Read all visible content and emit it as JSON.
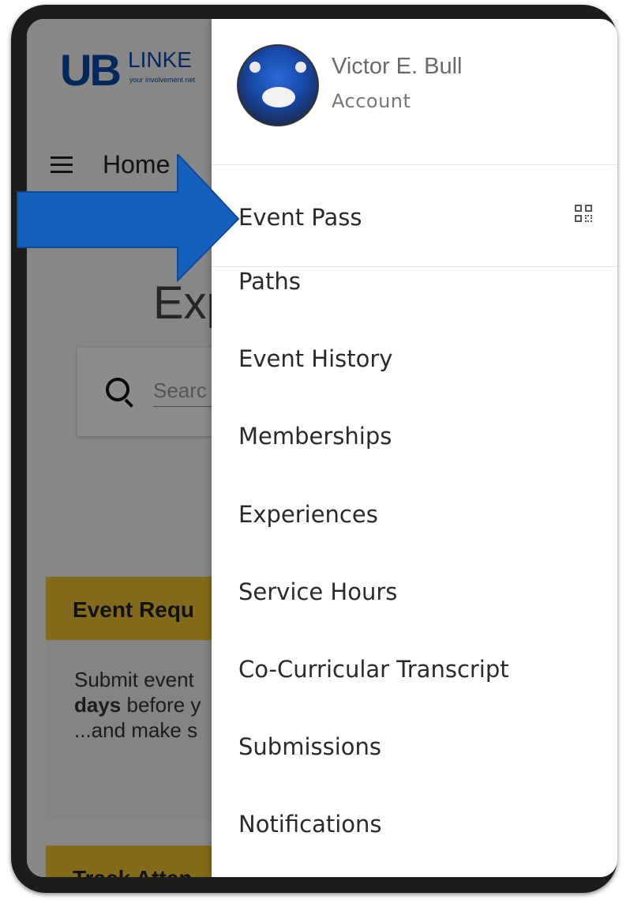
{
  "background_page": {
    "logo_ub": "UB",
    "logo_linked": "LINKE",
    "logo_tagline": "your involvement net",
    "nav_label": "Home",
    "heading": "Exp",
    "search_placeholder": "Searc",
    "event_requests_title": "Event Requ",
    "event_requests_line1": "Submit event",
    "event_requests_bold": "days",
    "event_requests_line2_rest": " before y",
    "event_requests_line3": "...and make s",
    "track_title": "Track Atten"
  },
  "drawer": {
    "user_name": "Victor E. Bull",
    "account_label": "Account",
    "event_pass_label": "Event Pass",
    "event_pass_icon": "qr-code-icon",
    "items": [
      {
        "label": "Paths"
      },
      {
        "label": "Event History"
      },
      {
        "label": "Memberships"
      },
      {
        "label": "Experiences"
      },
      {
        "label": "Service Hours"
      },
      {
        "label": "Co-Curricular Transcript"
      },
      {
        "label": "Submissions"
      },
      {
        "label": "Notifications"
      }
    ]
  },
  "annotation": {
    "arrow_color": "#1560bd",
    "arrow_target": "Event Pass"
  },
  "colors": {
    "brand_blue": "#0a4aa8",
    "card_gold": "#f1c232"
  }
}
